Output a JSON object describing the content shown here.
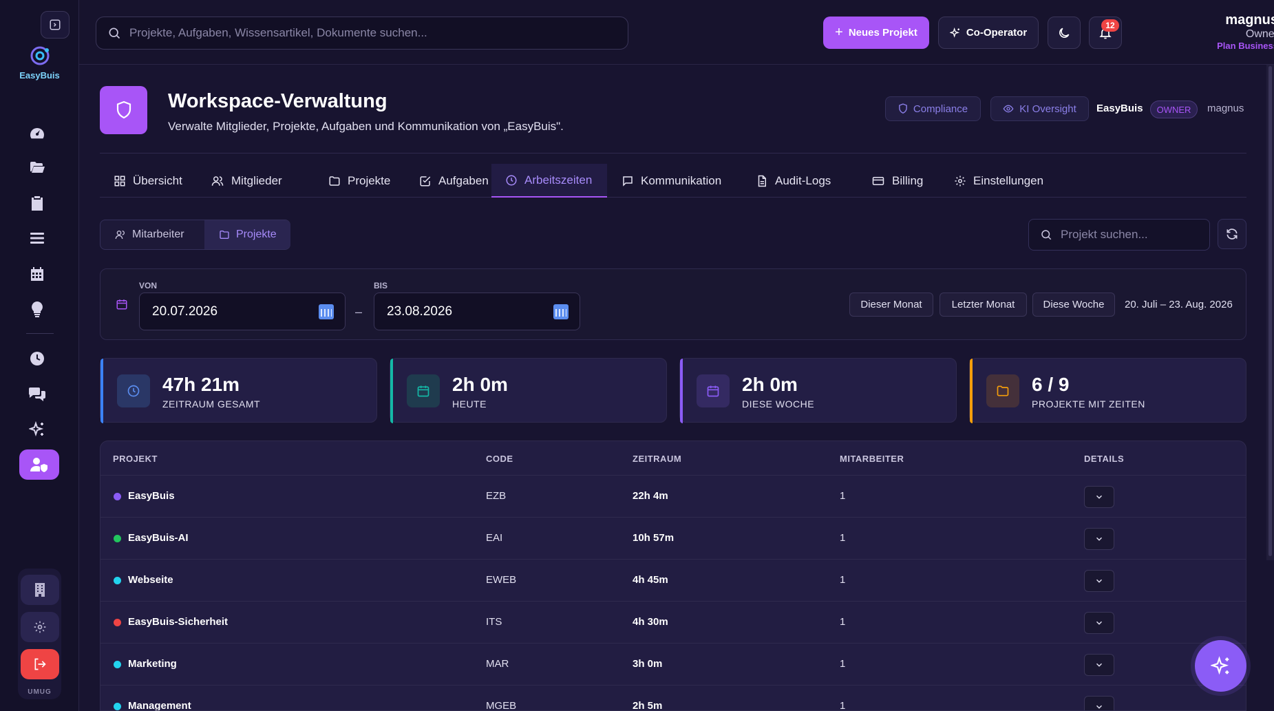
{
  "brand": {
    "name": "EasyBuis",
    "color": "#7dd3fc"
  },
  "topbar": {
    "search_placeholder": "Projekte, Aufgaben, Wissensartikel, Dokumente suchen...",
    "new_project_label": "Neues Projekt",
    "co_operator_label": "Co-Operator",
    "notification_count": "12",
    "user": {
      "name": "magnus",
      "role": "Owner",
      "plan": "Plan Business"
    }
  },
  "sidebar": {
    "items": [
      "dashboard-icon",
      "folder-icon",
      "clipboard-icon",
      "list-icon",
      "calendar-icon",
      "lightbulb-icon",
      "clock-icon",
      "chat-icon",
      "sparkles-icon",
      "user-shield-icon"
    ],
    "active": "user-shield-icon",
    "bottom": {
      "user_label": "UMUG"
    }
  },
  "header": {
    "title": "Workspace-Verwaltung",
    "subtitle": "Verwalte Mitglieder, Projekte, Aufgaben und Kommunikation von „EasyBuis\".",
    "compliance_label": "Compliance",
    "ki_label": "KI Oversight",
    "workspace_name": "EasyBuis",
    "owner_badge": "OWNER",
    "user": "magnus"
  },
  "tabs": [
    {
      "label": "Übersicht",
      "icon": "grid-icon"
    },
    {
      "label": "Mitglieder",
      "icon": "users-icon"
    },
    {
      "label": "Projekte",
      "icon": "folder-icon"
    },
    {
      "label": "Aufgaben",
      "icon": "check-square-icon"
    },
    {
      "label": "Arbeitszeiten",
      "icon": "clock-icon",
      "active": true
    },
    {
      "label": "Kommunikation",
      "icon": "message-icon"
    },
    {
      "label": "Audit-Logs",
      "icon": "file-icon"
    },
    {
      "label": "Billing",
      "icon": "card-icon"
    },
    {
      "label": "Einstellungen",
      "icon": "gear-icon"
    }
  ],
  "view_toggle": {
    "mitarbeiter": "Mitarbeiter",
    "projekte": "Projekte",
    "active": "projekte"
  },
  "project_search_placeholder": "Projekt suchen...",
  "filter": {
    "from_label": "VON",
    "from_value": "20.07.2026",
    "to_label": "BIS",
    "to_value": "23.08.2026",
    "separator": "–",
    "quick": [
      "Dieser Monat",
      "Letzter Monat",
      "Diese Woche"
    ],
    "range_text": "20. Juli – 23. Aug. 2026"
  },
  "stats": [
    {
      "value": "47h 21m",
      "label": "ZEITRAUM GESAMT",
      "color": "#3b82f6"
    },
    {
      "value": "2h 0m",
      "label": "HEUTE",
      "color": "#14b8a6"
    },
    {
      "value": "2h 0m",
      "label": "DIESE WOCHE",
      "color": "#8b5cf6"
    },
    {
      "value": "6 / 9",
      "label": "PROJEKTE MIT ZEITEN",
      "color": "#f59e0b"
    }
  ],
  "table": {
    "headers": [
      "PROJEKT",
      "CODE",
      "ZEITRAUM",
      "MITARBEITER",
      "DETAILS"
    ],
    "rows": [
      {
        "name": "EasyBuis",
        "code": "EZB",
        "time": "22h 4m",
        "members": "1",
        "color": "#8b5cf6"
      },
      {
        "name": "EasyBuis-AI",
        "code": "EAI",
        "time": "10h 57m",
        "members": "1",
        "color": "#22c55e"
      },
      {
        "name": "Webseite",
        "code": "EWEB",
        "time": "4h 45m",
        "members": "1",
        "color": "#22d3ee"
      },
      {
        "name": "EasyBuis-Sicherheit",
        "code": "ITS",
        "time": "4h 30m",
        "members": "1",
        "color": "#ef4444"
      },
      {
        "name": "Marketing",
        "code": "MAR",
        "time": "3h 0m",
        "members": "1",
        "color": "#22d3ee"
      },
      {
        "name": "Management",
        "code": "MGEB",
        "time": "2h 5m",
        "members": "1",
        "color": "#22d3ee"
      }
    ]
  }
}
